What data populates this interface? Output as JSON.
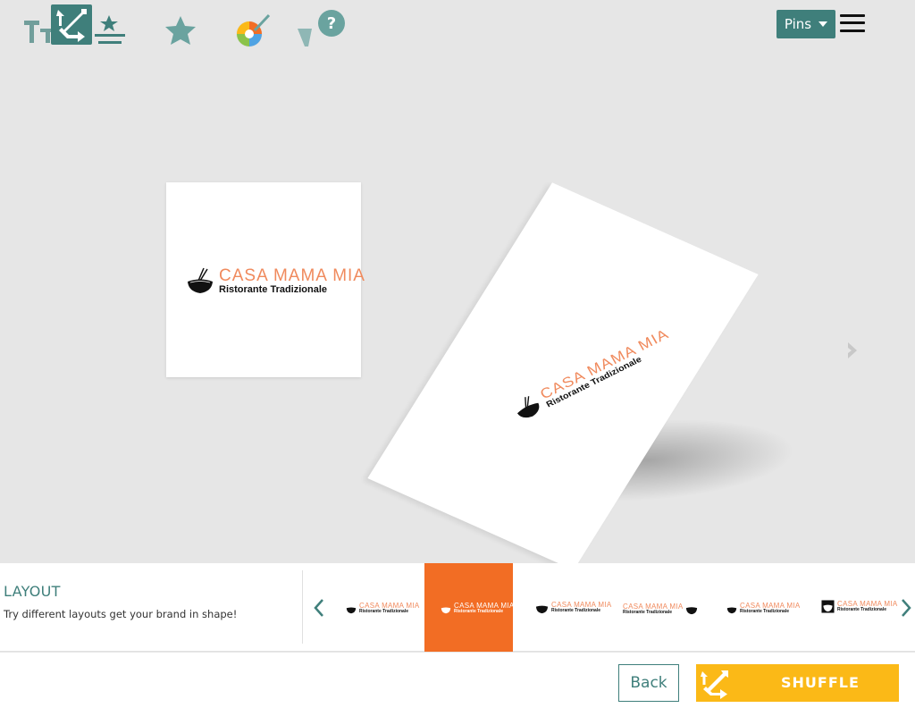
{
  "header": {
    "logo_icon": "shuffle-arrows-logo-icon",
    "pins_label": "Pins",
    "menu_icon": "hamburger-menu-icon"
  },
  "brand": {
    "name": "CASA MAMA MIA",
    "tagline": "Ristorante Tradizionale",
    "icon": "noodle-bowl-chopsticks-icon",
    "accent_color": "#f08a5d"
  },
  "preview": {
    "next_icon": "chevron-right-icon"
  },
  "layout_panel": {
    "title": "LAYOUT",
    "description": "Try different layouts get your brand in shape!",
    "prev_icon": "chevron-left-icon",
    "next_icon": "chevron-right-icon",
    "thumbnails": [
      {
        "name": "CASA MAMA MIA",
        "tag": "Ristorante Tradizionale",
        "active": false
      },
      {
        "name": "CASA MAMA MIA",
        "tag": "Ristorante Tradizionale",
        "active": true
      },
      {
        "name": "CASA MAMA MIA",
        "tag": "Ristorante Tradizionale",
        "active": false
      },
      {
        "name": "CASA MAMA MIA",
        "tag": "Ristorante Tradizionale",
        "active": false
      },
      {
        "name": "CASA MAMA MIA",
        "tag": "Ristorante Tradizionale",
        "active": false
      },
      {
        "name": "CASA MAMA MIA",
        "tag": "Ristorante Tradizionale",
        "active": false
      }
    ],
    "active_color": "#f26d24"
  },
  "toolbar": {
    "tools": [
      "text-icon",
      "style-icon",
      "star-icon",
      "color-palette-icon",
      "help-icon"
    ],
    "back_label": "Back",
    "shuffle_label": "SHUFFLE",
    "shuffle_color": "#fbb917",
    "brand_color": "#3f7f7b"
  }
}
